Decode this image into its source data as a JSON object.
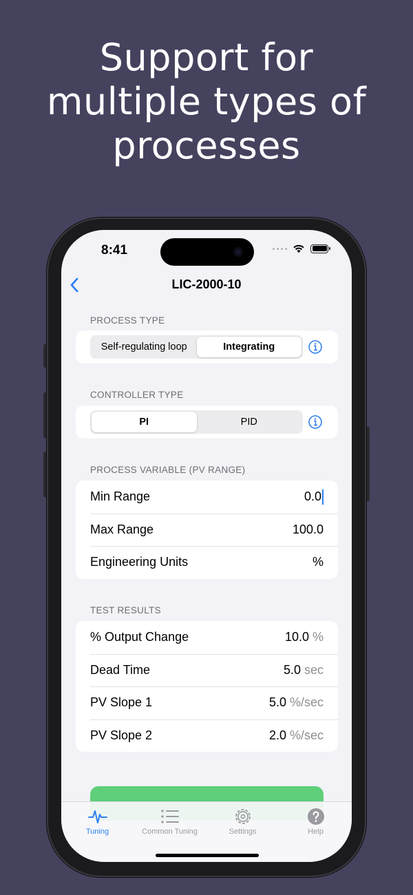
{
  "headline": {
    "line1": "Support for",
    "line2": "multiple types of",
    "line3": "processes"
  },
  "status_bar": {
    "time": "8:41"
  },
  "nav": {
    "title": "LIC-2000-10"
  },
  "process_type": {
    "header": "PROCESS TYPE",
    "options": [
      "Self-regulating loop",
      "Integrating"
    ],
    "selected": "Integrating"
  },
  "controller_type": {
    "header": "CONTROLLER TYPE",
    "options": [
      "PI",
      "PID"
    ],
    "selected": "PI"
  },
  "pv_range": {
    "header": "PROCESS VARIABLE (PV RANGE)",
    "rows": [
      {
        "label": "Min Range",
        "value": "0.0"
      },
      {
        "label": "Max Range",
        "value": "100.0"
      },
      {
        "label": "Engineering Units",
        "value": "%"
      }
    ]
  },
  "test_results": {
    "header": "TEST RESULTS",
    "rows": [
      {
        "label": "% Output Change",
        "value": "10.0",
        "unit": "%"
      },
      {
        "label": "Dead Time",
        "value": "5.0",
        "unit": "sec"
      },
      {
        "label": "PV Slope 1",
        "value": "5.0",
        "unit": "%/sec"
      },
      {
        "label": "PV Slope 2",
        "value": "2.0",
        "unit": "%/sec"
      }
    ]
  },
  "tabs": [
    {
      "label": "Tuning",
      "icon": "waveform-icon",
      "active": true
    },
    {
      "label": "Common Tuning",
      "icon": "list-icon",
      "active": false
    },
    {
      "label": "Settings",
      "icon": "gear-icon",
      "active": false
    },
    {
      "label": "Help",
      "icon": "question-icon",
      "active": false
    }
  ],
  "colors": {
    "background": "#45425e",
    "accent": "#2f7ff0",
    "calculate_button": "#5fcf7a"
  }
}
